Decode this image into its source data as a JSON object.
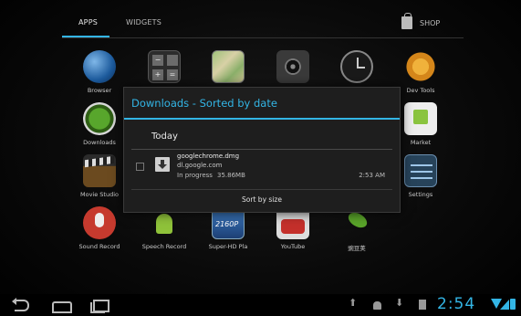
{
  "tabs": {
    "apps_label": "APPS",
    "widgets_label": "WIDGETS",
    "shop_label": "SHOP"
  },
  "apps": [
    {
      "label": "Browser",
      "icon": "globe-icon"
    },
    {
      "label": "",
      "icon": "calculator-icon"
    },
    {
      "label": "",
      "icon": "gallery-icon"
    },
    {
      "label": "",
      "icon": "camera-icon"
    },
    {
      "label": "",
      "icon": "clock-icon"
    },
    {
      "label": "Dev Tools",
      "icon": "dev-tools-icon"
    },
    {
      "label": "Downloads",
      "icon": "download-icon"
    },
    {
      "label": "Market",
      "icon": "market-icon"
    },
    {
      "label": "Movie Studio",
      "icon": "movie-studio-icon"
    },
    {
      "label": "Settings",
      "icon": "settings-icon"
    },
    {
      "label": "Sound Record",
      "icon": "microphone-icon"
    },
    {
      "label": "Speech Record",
      "icon": "android-icon"
    },
    {
      "label": "Super-HD Pla",
      "icon": "hd-video-icon"
    },
    {
      "label": "YouTube",
      "icon": "youtube-icon"
    },
    {
      "label": "豌豆荚",
      "icon": "pea-icon"
    }
  ],
  "dialog": {
    "title": "Downloads - Sorted by date",
    "section": "Today",
    "item": {
      "filename": "googlechrome.dmg",
      "source": "dl.google.com",
      "status": "In progress",
      "size": "35.86MB",
      "time": "2:53 AM"
    },
    "sort_button": "Sort by size"
  },
  "statusbar": {
    "clock": "2:54"
  },
  "colors": {
    "accent": "#33b5e5",
    "background": "#050505",
    "dialog_bg": "#1e1e1e"
  }
}
